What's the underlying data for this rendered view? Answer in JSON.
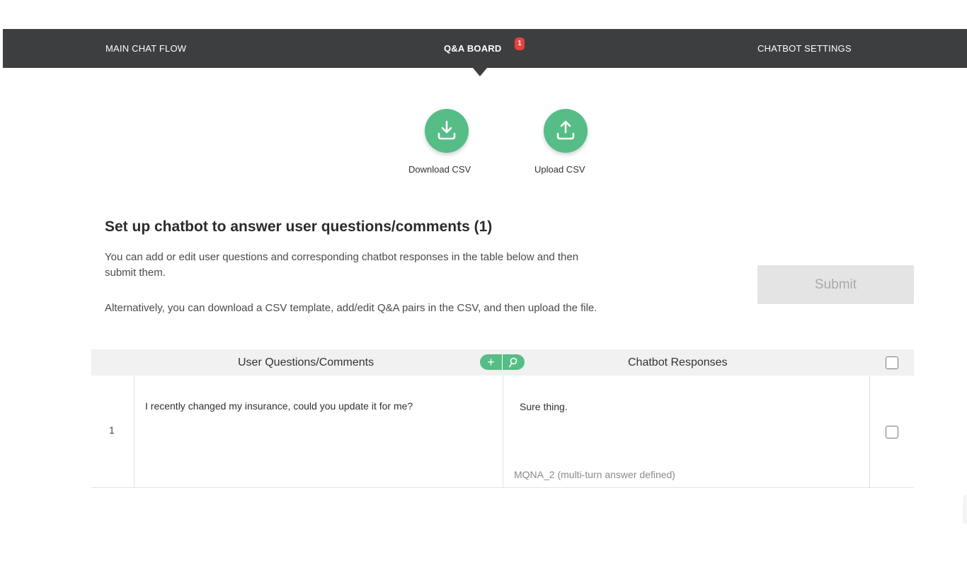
{
  "nav": {
    "items": [
      {
        "label": "MAIN CHAT FLOW"
      },
      {
        "label": "Q&A BOARD"
      },
      {
        "label": "CHATBOT SETTINGS"
      }
    ],
    "badge": "1"
  },
  "csv": {
    "download": {
      "label": "Download CSV",
      "icon": "download-icon"
    },
    "upload": {
      "label": "Upload CSV",
      "icon": "upload-icon"
    }
  },
  "section": {
    "title": "Set up chatbot to answer user questions/comments (1)",
    "description_1": "You can add or edit user questions and corresponding chatbot responses in the table below and then submit them.",
    "description_2": "Alternatively, you can download a CSV template, add/edit Q&A pairs in the CSV, and then upload the file."
  },
  "submit": {
    "label": "Submit"
  },
  "table": {
    "headers": {
      "questions": "User Questions/Comments",
      "responses": "Chatbot Responses",
      "add_icon": "plus-icon",
      "search_icon": "search-icon"
    },
    "rows": [
      {
        "index": "1",
        "question": "I recently changed my insurance, could you update it for me?",
        "response": "Sure thing.",
        "note": "MQNA_2 (multi-turn answer defined)"
      }
    ]
  },
  "colors": {
    "nav_bg": "#3d3e40",
    "accent_green": "#56bd87",
    "badge_red": "#e8413c",
    "submit_disabled_bg": "#e4e4e4"
  }
}
